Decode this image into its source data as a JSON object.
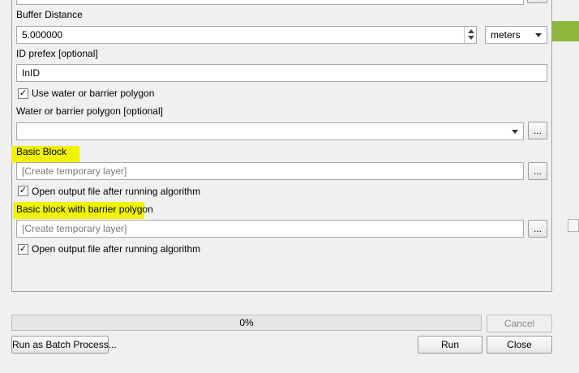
{
  "buffer_distance": {
    "label": "Buffer Distance",
    "value": "5.000000",
    "unit": "meters"
  },
  "id_prefix": {
    "label": "ID prefex [optional]",
    "value": "InID"
  },
  "use_water_barrier": {
    "label": "Use water or barrier polygon",
    "checked": "✓"
  },
  "water_barrier_polygon": {
    "label": "Water or barrier polygon [optional]",
    "browse": "..."
  },
  "basic_block": {
    "label": "Basic Block",
    "placeholder": "[Create temporary layer]",
    "browse": "...",
    "open_output_label": "Open output file after running algorithm",
    "checked": "✓"
  },
  "basic_block_barrier": {
    "label": "Basic block with barrier polygon",
    "placeholder": "[Create temporary layer]",
    "browse": "...",
    "open_output_label": "Open output file after running algorithm",
    "checked": "✓"
  },
  "progress": {
    "percent_label": "0%",
    "value": 0
  },
  "buttons": {
    "cancel": "Cancel",
    "run_batch": "Run as Batch Process...",
    "run": "Run",
    "close": "Close"
  },
  "colors": {
    "highlight": "#f2f300",
    "layer_panel_green": "#8cb63c"
  }
}
